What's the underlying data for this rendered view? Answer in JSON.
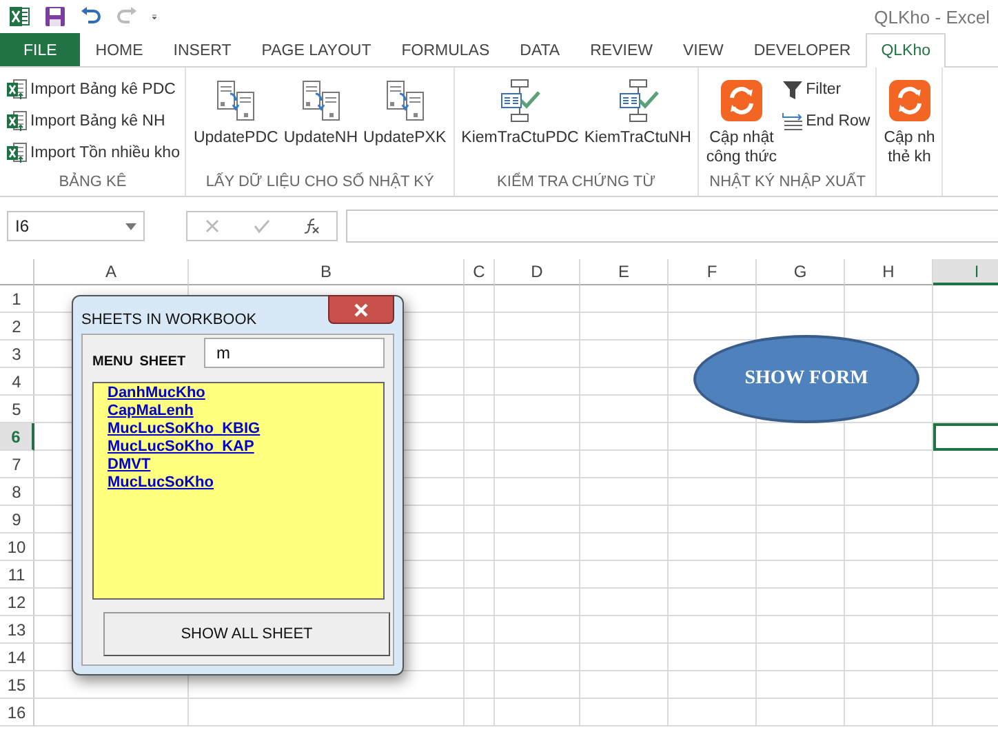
{
  "title_bar": {
    "title": "QLKho - Excel"
  },
  "tabs": [
    {
      "label": "FILE",
      "kind": "file",
      "selected": false
    },
    {
      "label": "HOME",
      "kind": "tab",
      "selected": false
    },
    {
      "label": "INSERT",
      "kind": "tab",
      "selected": false
    },
    {
      "label": "PAGE LAYOUT",
      "kind": "tab",
      "selected": false
    },
    {
      "label": "FORMULAS",
      "kind": "tab",
      "selected": false
    },
    {
      "label": "DATA",
      "kind": "tab",
      "selected": false
    },
    {
      "label": "REVIEW",
      "kind": "tab",
      "selected": false
    },
    {
      "label": "VIEW",
      "kind": "tab",
      "selected": false
    },
    {
      "label": "DEVELOPER",
      "kind": "tab",
      "selected": false
    },
    {
      "label": "QLKho",
      "kind": "tab",
      "selected": true
    }
  ],
  "ribbon": {
    "groups": [
      {
        "label": "BẢNG KÊ",
        "items": [
          {
            "kind": "import",
            "lines": [
              "Import Bảng kê PDC"
            ]
          },
          {
            "kind": "import",
            "lines": [
              "Import Bảng kê NH"
            ]
          },
          {
            "kind": "import",
            "lines": [
              "Import Tồn nhiều kho"
            ]
          }
        ]
      },
      {
        "label": "LẤY DỮ LIỆU CHO SỐ NHẬT KÝ",
        "items": [
          {
            "kind": "update",
            "lines": [
              "UpdatePDC"
            ]
          },
          {
            "kind": "update",
            "lines": [
              "UpdateNH"
            ]
          },
          {
            "kind": "update",
            "lines": [
              "UpdatePXK"
            ]
          }
        ]
      },
      {
        "label": "KIỂM TRA CHỨNG TỪ",
        "items": [
          {
            "kind": "check",
            "lines": [
              "KiemTraCtuPDC"
            ]
          },
          {
            "kind": "check",
            "lines": [
              "KiemTraCtuNH"
            ]
          }
        ]
      },
      {
        "label": "NHẬT KÝ NHẬP XUẤT",
        "items": [
          {
            "kind": "refresh",
            "lines": [
              "Cập nhật",
              "công thức"
            ]
          },
          {
            "kind": "filter",
            "lines": [
              "Filter"
            ]
          },
          {
            "kind": "endrow",
            "lines": [
              "End Row"
            ]
          }
        ]
      },
      {
        "items": [
          {
            "kind": "refresh",
            "lines": [
              "Cập nh",
              "thẻ kh"
            ]
          }
        ]
      }
    ]
  },
  "formula_bar": {
    "name_box": "I6"
  },
  "sheet": {
    "columns": [
      {
        "label": "A",
        "selected": false
      },
      {
        "label": "B",
        "selected": false
      },
      {
        "label": "C",
        "selected": false
      },
      {
        "label": "D",
        "selected": false
      },
      {
        "label": "E",
        "selected": false
      },
      {
        "label": "F",
        "selected": false
      },
      {
        "label": "G",
        "selected": false
      },
      {
        "label": "H",
        "selected": false
      },
      {
        "label": "I",
        "selected": true
      }
    ],
    "rows": [
      {
        "label": "1",
        "selected": false
      },
      {
        "label": "2",
        "selected": false
      },
      {
        "label": "3",
        "selected": false
      },
      {
        "label": "4",
        "selected": false
      },
      {
        "label": "5",
        "selected": false
      },
      {
        "label": "6",
        "selected": true
      },
      {
        "label": "7",
        "selected": false
      },
      {
        "label": "8",
        "selected": false
      },
      {
        "label": "9",
        "selected": false
      },
      {
        "label": "10",
        "selected": false
      },
      {
        "label": "11",
        "selected": false
      },
      {
        "label": "12",
        "selected": false
      },
      {
        "label": "13",
        "selected": false
      },
      {
        "label": "14",
        "selected": false
      },
      {
        "label": "15",
        "selected": false
      },
      {
        "label": "16",
        "selected": false
      }
    ]
  },
  "shape": {
    "label": "SHOW FORM"
  },
  "dialog": {
    "title": "SHEETS IN WORKBOOK",
    "menu_label": "MENU SHEET",
    "search_value": "m",
    "sheets": [
      "DanhMucKho",
      "CapMaLenh",
      "MucLucSoKho_KBIG",
      "MucLucSoKho_KAP",
      "DMVT",
      "MucLucSoKho"
    ],
    "button": "SHOW ALL SHEET"
  }
}
